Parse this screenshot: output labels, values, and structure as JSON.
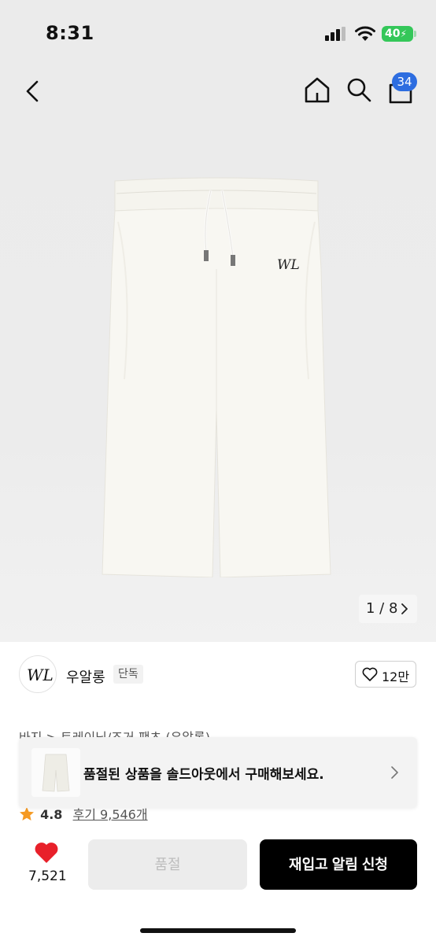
{
  "status_bar": {
    "time": "8:31",
    "battery": "40"
  },
  "nav": {
    "back_icon": "chevron-left-icon",
    "home_icon": "home-icon",
    "search_icon": "search-icon",
    "cart_icon": "bag-icon",
    "cart_count": "34"
  },
  "gallery": {
    "current": "1 / 8"
  },
  "brand": {
    "logo_text": "WL",
    "name": "우알롱",
    "tag": "단독",
    "like_count": "12만"
  },
  "breadcrumb": "바지 > 트레이닝/조거 팬츠 (우알롱)",
  "rating": {
    "score": "4.8",
    "reviews": "후기 9,546개"
  },
  "soldout_banner": {
    "text": "품절된 상품을 솔드아웃에서 구매해보세요."
  },
  "bottom_bar": {
    "wish_count": "7,521",
    "soldout_label": "품절",
    "restock_label": "재입고 알림 신청"
  },
  "colors": {
    "accent_blue": "#2d6de0",
    "heart_red": "#e8202a",
    "star_orange": "#f59a23",
    "battery_green": "#34c759"
  }
}
